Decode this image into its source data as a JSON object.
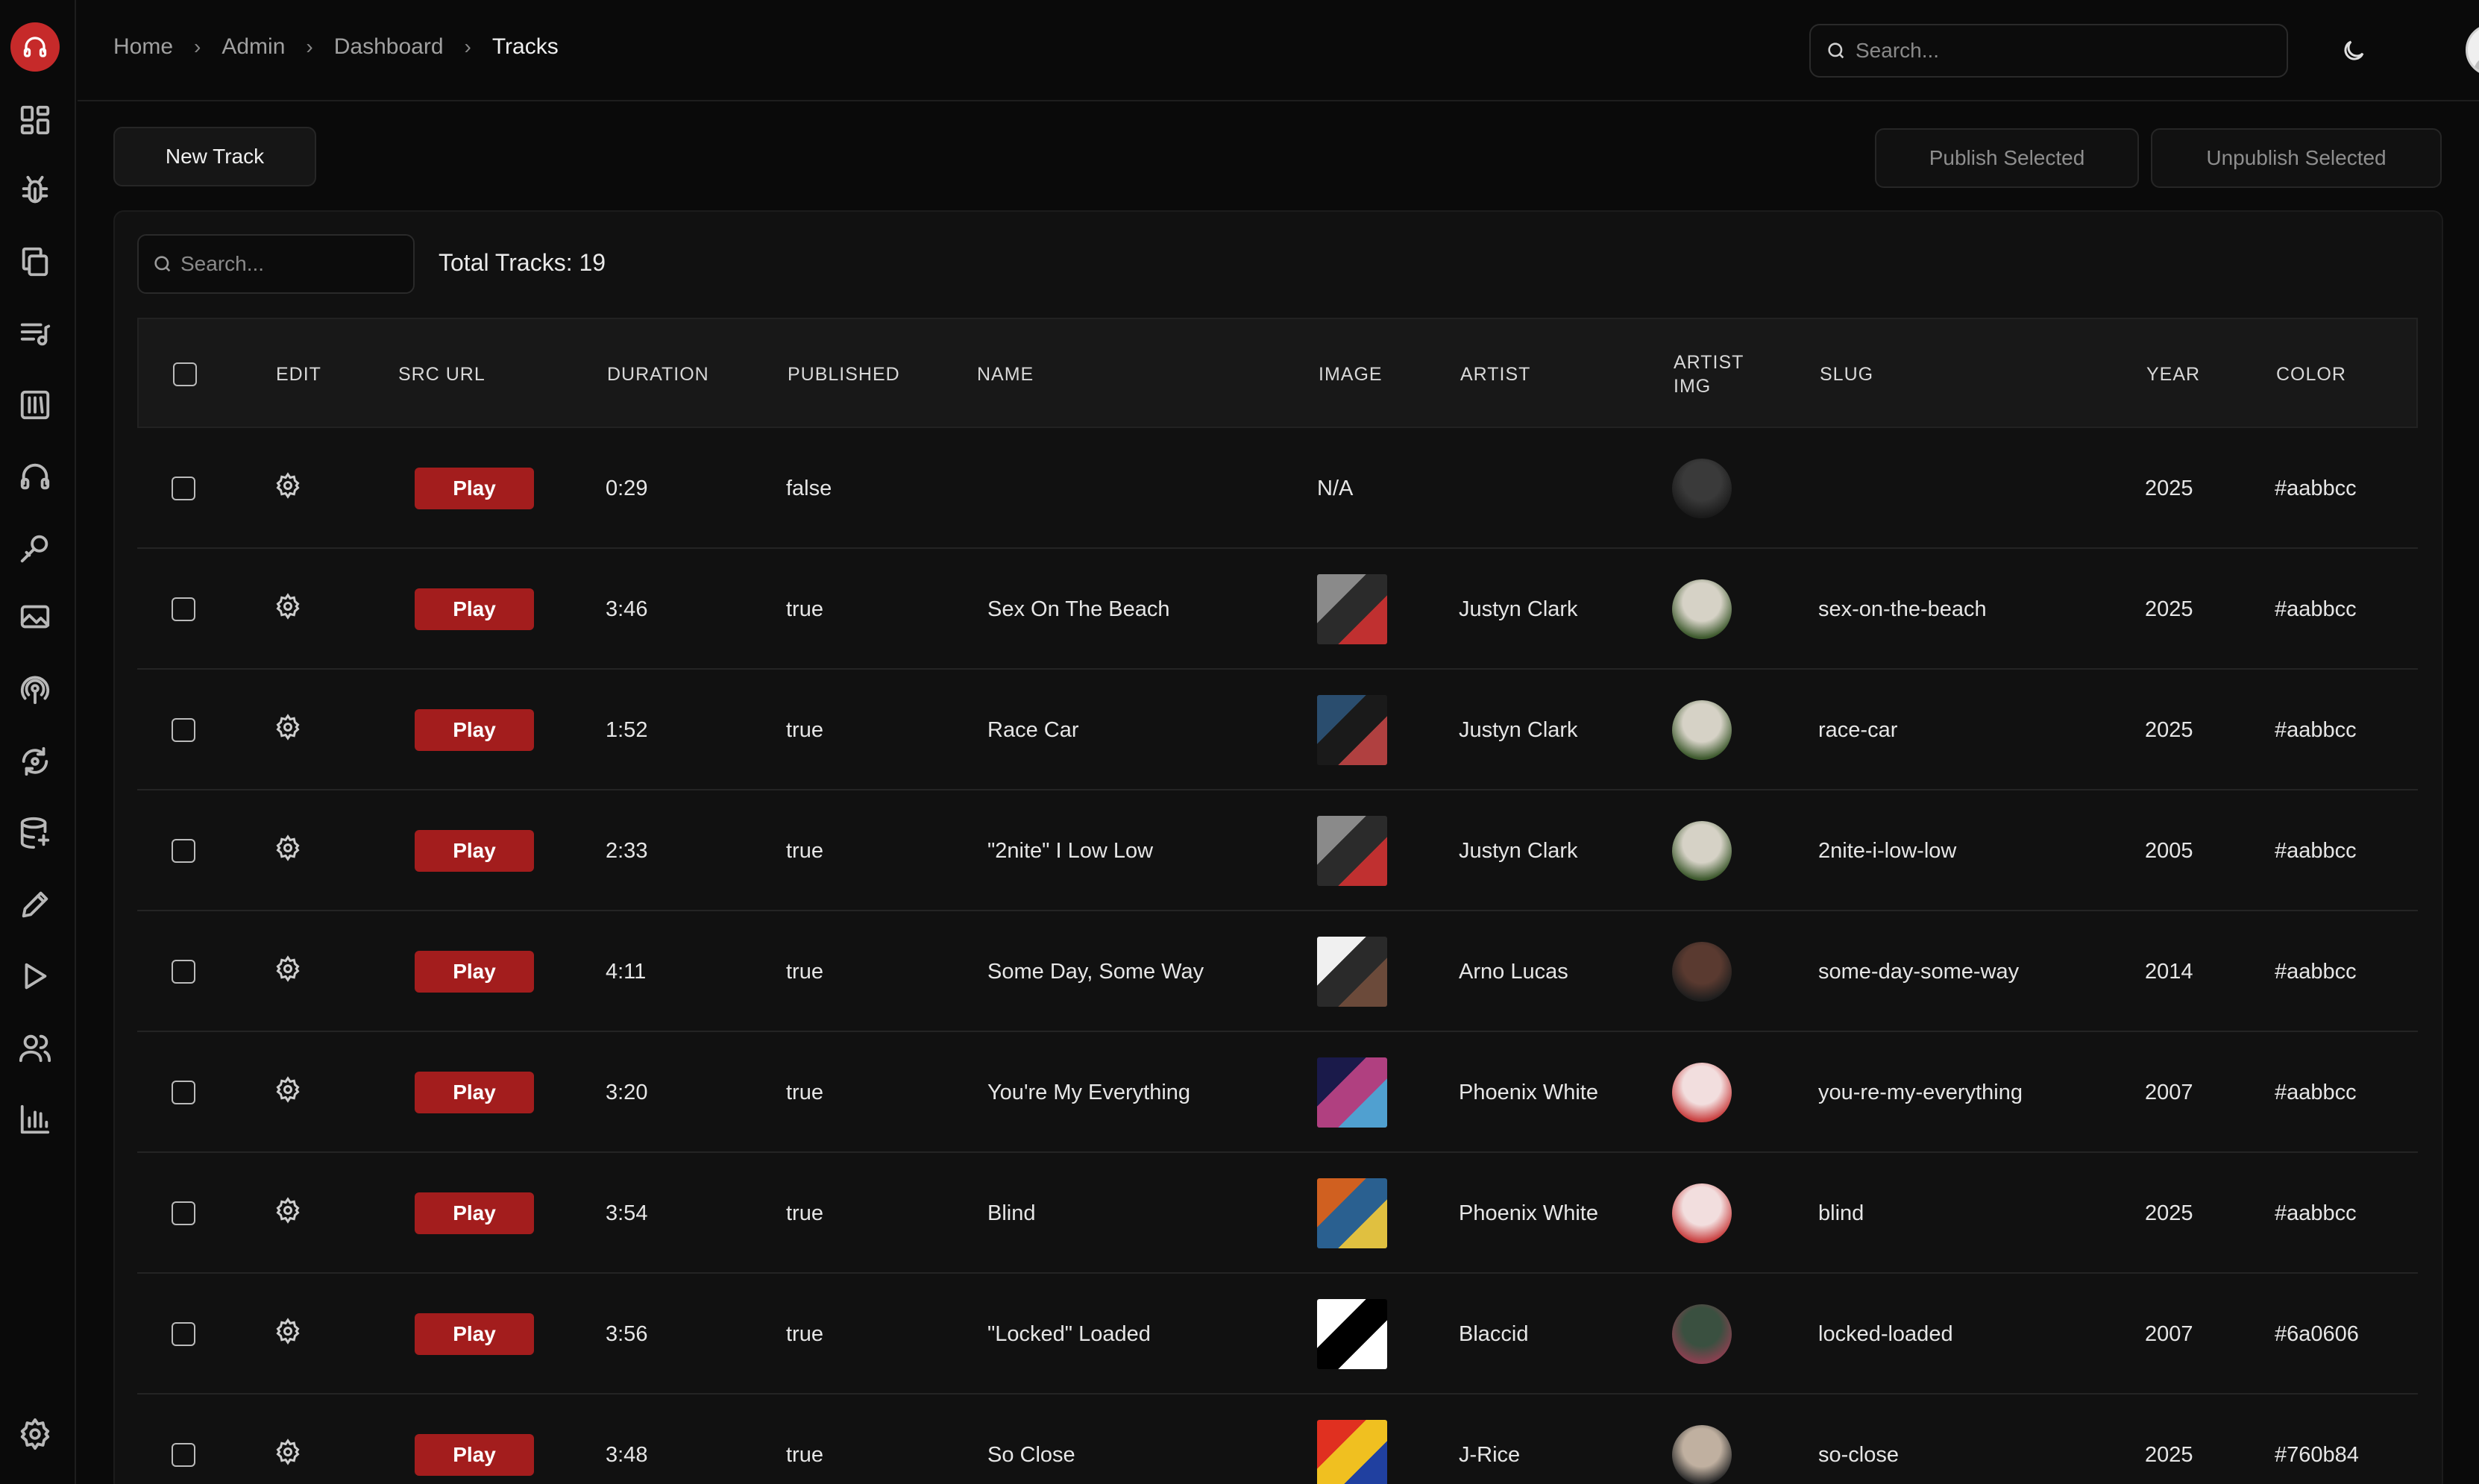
{
  "breadcrumb": [
    {
      "label": "Home"
    },
    {
      "label": "Admin"
    },
    {
      "label": "Dashboard"
    },
    {
      "label": "Tracks"
    }
  ],
  "top_search": {
    "placeholder": "Search..."
  },
  "sidebar_icons": [
    "headphones-logo-icon",
    "dashboard-icon",
    "bug-icon",
    "copy-icon",
    "playlist-icon",
    "library-icon",
    "headphones-icon",
    "microphone-icon",
    "image-icon",
    "podcast-icon",
    "refresh-icon",
    "database-icon",
    "pencil-icon",
    "play-icon",
    "users-icon",
    "bar-chart-icon",
    "settings-icon"
  ],
  "actions": {
    "new_track": "New Track",
    "publish_selected": "Publish Selected",
    "unpublish_selected": "Unpublish Selected"
  },
  "table_search": {
    "placeholder": "Search..."
  },
  "total_tracks": "Total Tracks: 19",
  "columns": {
    "edit": "EDIT",
    "src_url": "SRC URL",
    "duration": "DURATION",
    "published": "PUBLISHED",
    "name": "NAME",
    "image": "IMAGE",
    "artist": "ARTIST",
    "artist_img_1": "ARTIST",
    "artist_img_2": "IMG",
    "slug": "SLUG",
    "year": "YEAR",
    "color": "COLOR"
  },
  "play_label": "Play",
  "rows": [
    {
      "duration": "0:29",
      "published": "false",
      "name": "",
      "image": "N/A",
      "artist": "",
      "slug": "",
      "year": "2025",
      "color": "#aabbcc",
      "thumb_colors": [],
      "artist_colors": [
        "#3a3a3a",
        "#1a1a1a"
      ]
    },
    {
      "duration": "3:46",
      "published": "true",
      "name": "Sex On The Beach",
      "image": "",
      "artist": "Justyn Clark",
      "slug": "sex-on-the-beach",
      "year": "2025",
      "color": "#aabbcc",
      "thumb_colors": [
        "#8a8a8a",
        "#2b2b2b",
        "#c03030"
      ],
      "artist_colors": [
        "#d6d2c6",
        "#3e5a2e"
      ]
    },
    {
      "duration": "1:52",
      "published": "true",
      "name": "Race Car",
      "image": "",
      "artist": "Justyn Clark",
      "slug": "race-car",
      "year": "2025",
      "color": "#aabbcc",
      "thumb_colors": [
        "#2a4d6e",
        "#1a1a1a",
        "#b04040"
      ],
      "artist_colors": [
        "#d6d2c6",
        "#3e5a2e"
      ]
    },
    {
      "duration": "2:33",
      "published": "true",
      "name": "\"2nite\" I Low Low",
      "image": "",
      "artist": "Justyn Clark",
      "slug": "2nite-i-low-low",
      "year": "2005",
      "color": "#aabbcc",
      "thumb_colors": [
        "#8a8a8a",
        "#2b2b2b",
        "#c03030"
      ],
      "artist_colors": [
        "#d6d2c6",
        "#3e5a2e"
      ]
    },
    {
      "duration": "4:11",
      "published": "true",
      "name": "Some Day, Some Way",
      "image": "",
      "artist": "Arno Lucas",
      "slug": "some-day-some-way",
      "year": "2014",
      "color": "#aabbcc",
      "thumb_colors": [
        "#f0f0f0",
        "#2a2a2a",
        "#6b4a3a"
      ],
      "artist_colors": [
        "#5a3a30",
        "#1e1e1e"
      ]
    },
    {
      "duration": "3:20",
      "published": "true",
      "name": "You're My Everything",
      "image": "",
      "artist": "Phoenix White",
      "slug": "you-re-my-everything",
      "year": "2007",
      "color": "#aabbcc",
      "thumb_colors": [
        "#1a1a4a",
        "#b04080",
        "#50a0d0"
      ],
      "artist_colors": [
        "#f2dede",
        "#c94040"
      ]
    },
    {
      "duration": "3:54",
      "published": "true",
      "name": "Blind",
      "image": "",
      "artist": "Phoenix White",
      "slug": "blind",
      "year": "2025",
      "color": "#aabbcc",
      "thumb_colors": [
        "#d06020",
        "#2a6090",
        "#e0c040"
      ],
      "artist_colors": [
        "#f2dede",
        "#c94040"
      ]
    },
    {
      "duration": "3:56",
      "published": "true",
      "name": "\"Locked\" Loaded",
      "image": "",
      "artist": "Blaccid",
      "slug": "locked-loaded",
      "year": "2007",
      "color": "#6a0606",
      "thumb_colors": [
        "#ffffff",
        "#000000",
        "#ffffff"
      ],
      "artist_colors": [
        "#3a5040",
        "#8a4050"
      ]
    },
    {
      "duration": "3:48",
      "published": "true",
      "name": "So Close",
      "image": "",
      "artist": "J-Rice",
      "slug": "so-close",
      "year": "2025",
      "color": "#760b84",
      "thumb_colors": [
        "#e03020",
        "#f0c020",
        "#2040a0"
      ],
      "artist_colors": [
        "#c0b0a0",
        "#2a2a2a"
      ]
    }
  ]
}
